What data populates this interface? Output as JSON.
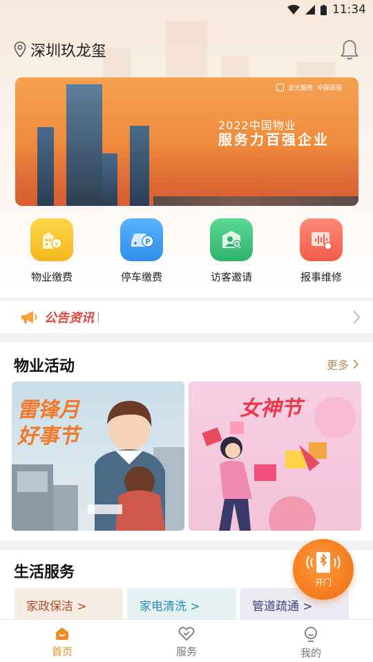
{
  "status_bar": {
    "time": "11:34"
  },
  "header": {
    "location": "深圳玖龙玺"
  },
  "banner": {
    "brand_1": "龙光服务",
    "brand_2": "中国百强",
    "line1": "2022中国物业",
    "line2": "服务力百强企业"
  },
  "quick_actions": [
    {
      "label": "物业缴费",
      "icon": "property-fee-icon",
      "color": "#f7c325"
    },
    {
      "label": "停车缴费",
      "icon": "parking-fee-icon",
      "color": "#3d9af0"
    },
    {
      "label": "访客邀请",
      "icon": "visitor-invite-icon",
      "color": "#3fc47e"
    },
    {
      "label": "报事维修",
      "icon": "repair-report-icon",
      "color": "#f27060"
    }
  ],
  "notice": {
    "label": "公告资讯"
  },
  "activities": {
    "title": "物业活动",
    "more": "更多",
    "cards": [
      {
        "title_line1": "雷锋月",
        "title_line2": "好事节"
      },
      {
        "title_line1": "女神节"
      }
    ]
  },
  "life_services": {
    "title": "生活服务",
    "items": [
      {
        "label": "家政保洁 >",
        "color": "#b4492a",
        "bg": "#f6ede4"
      },
      {
        "label": "家电清洗 >",
        "color": "#2b8ab0",
        "bg": "#e5f1f3"
      },
      {
        "label": "管道疏通 >",
        "color": "#3b3f7a",
        "bg": "#eceaf3"
      }
    ]
  },
  "fab": {
    "label": "开门"
  },
  "tabbar": {
    "tabs": [
      {
        "label": "首页",
        "active": true
      },
      {
        "label": "服务",
        "active": false
      },
      {
        "label": "我的",
        "active": false
      }
    ]
  },
  "colors": {
    "accent": "#f08a24",
    "notice_red": "#e8423a",
    "more_gold": "#b08a5a"
  }
}
